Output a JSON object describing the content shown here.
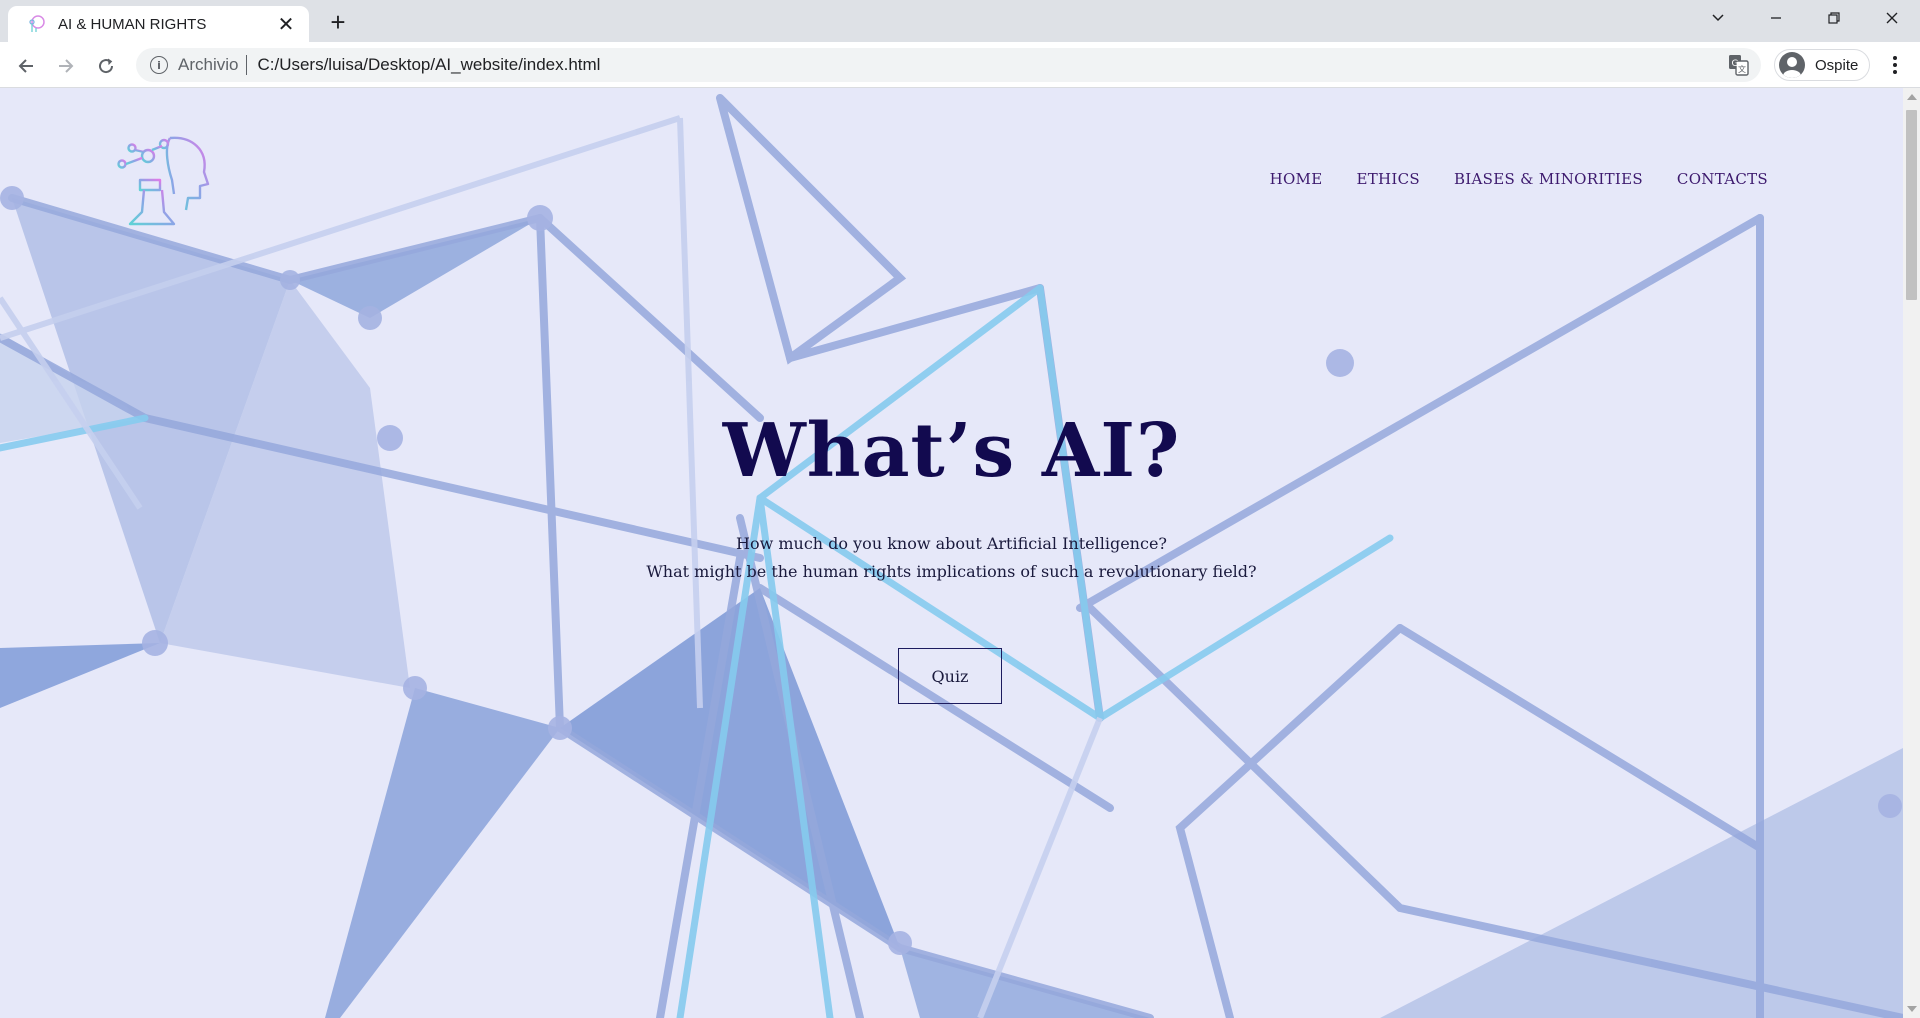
{
  "browser": {
    "tab_title": "AI & HUMAN RIGHTS",
    "new_tab_label": "+",
    "address_scheme": "Archivio",
    "address_url": "C:/Users/luisa/Desktop/AI_website/index.html",
    "profile_name": "Ospite"
  },
  "site": {
    "nav": [
      "HOME",
      "ETHICS",
      "BIASES & MINORITIES",
      "CONTACTS"
    ],
    "hero_title": "What’s AI?",
    "hero_line1": "How much do you know about Artificial Intelligence?",
    "hero_line2": "What might be the human rights implications of such a revolutionary field?",
    "quiz_label": "Quiz"
  },
  "colors": {
    "page_bg": "#e6e8f9",
    "nav_text": "#3d1a6e",
    "title": "#120a4f",
    "accent_blue": "#8ea6dc",
    "accent_cyan": "#87d3ee"
  },
  "icons": {
    "tab_favicon": "ai-head-icon",
    "logo": "ai-head-logo-icon",
    "info": "info-icon",
    "translate": "translate-icon",
    "avatar": "person-avatar-icon"
  }
}
